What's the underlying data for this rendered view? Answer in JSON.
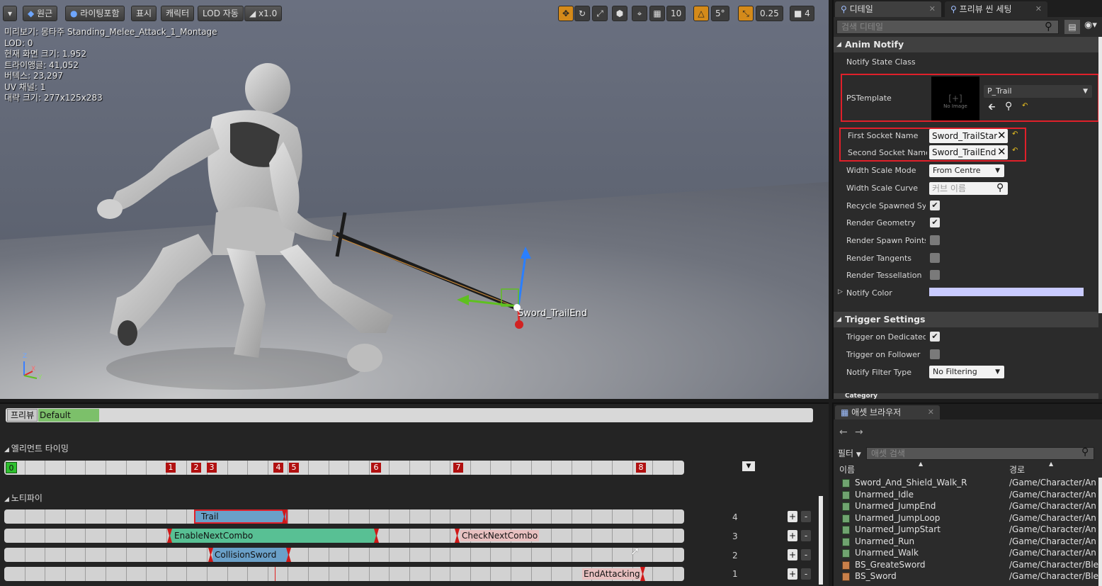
{
  "viewport": {
    "toolbar": {
      "perspective": "원근",
      "lighting": "라이팅포함",
      "show": "표시",
      "character": "캐릭터",
      "lod": "LOD 자동",
      "speed": "x1.0",
      "grid_snap": "10",
      "rotation_snap": "5°",
      "scale_snap": "0.25",
      "camera_speed": "4"
    },
    "stats": [
      "미리보기: 몽타주 Standing_Melee_Attack_1_Montage",
      "LOD: 0",
      "현재 화면 크기: 1.952",
      "트라이앵글: 41,052",
      "버텍스: 23,297",
      "UV 채널: 1",
      "대략 크기: 277x125x283"
    ],
    "socket_label": "Sword_TrailEnd",
    "axis": {
      "z": "Z",
      "x": "X",
      "y": "Y"
    }
  },
  "details": {
    "tabs": [
      {
        "label": "디테일"
      },
      {
        "label": "프리뷰 씬 세팅"
      }
    ],
    "search_placeholder": "검색 디테일",
    "anim_notify": {
      "title": "Anim Notify",
      "notify_state_class_label": "Notify State Class",
      "pstemplate_label": "PSTemplate",
      "pstemplate_value": "P_Trail",
      "thumb_text": "No Image",
      "first_socket_label": "First Socket Name",
      "first_socket_value": "Sword_TrailStar",
      "second_socket_label": "Second Socket Name",
      "second_socket_value": "Sword_TrailEnd",
      "width_scale_mode_label": "Width Scale Mode",
      "width_scale_mode_value": "From Centre",
      "width_scale_curve_label": "Width Scale Curve",
      "width_scale_curve_placeholder": "커브 이름",
      "recycle_label": "Recycle Spawned Systems",
      "render_geometry_label": "Render Geometry",
      "render_spawn_points_label": "Render Spawn Points",
      "render_tangents_label": "Render Tangents",
      "render_tessellation_label": "Render Tessellation",
      "notify_color_label": "Notify Color",
      "notify_color": "#c9cbff"
    },
    "trigger_settings": {
      "title": "Trigger Settings",
      "dedicated_label": "Trigger on Dedicated Server",
      "follower_label": "Trigger on Follower",
      "filter_type_label": "Notify Filter Type",
      "filter_type_value": "No Filtering"
    },
    "next_category": "Category"
  },
  "timeline": {
    "preview_label": "프리뷰",
    "preview_slot": "Default",
    "element_timing_label": "엘리먼트 타이밍",
    "first_marker": "0",
    "markers": [
      "1",
      "2",
      "3",
      "4",
      "5",
      "6",
      "7",
      "8"
    ],
    "notifies_label": "노티파이",
    "tracks": [
      {
        "number": "4",
        "notifies": [
          {
            "name": "Trail"
          }
        ]
      },
      {
        "number": "3",
        "notifies": [
          {
            "name": "EnableNextCombo"
          },
          {
            "name": "CheckNextCombo"
          }
        ]
      },
      {
        "number": "2",
        "notifies": [
          {
            "name": "CollisionSword"
          }
        ]
      },
      {
        "number": "1",
        "notifies": [
          {
            "name": "EndAttacking"
          }
        ]
      }
    ],
    "plus": "+",
    "minus": "-"
  },
  "assets": {
    "tab_label": "애셋 브라우저",
    "filter_label": "필터",
    "search_placeholder": "애셋 검색",
    "col_name": "이름",
    "col_path": "경로",
    "rows": [
      {
        "name": "Sword_And_Shield_Walk_R",
        "path": "/Game/Character/An",
        "type": "anim"
      },
      {
        "name": "Unarmed_Idle",
        "path": "/Game/Character/An",
        "type": "anim"
      },
      {
        "name": "Unarmed_JumpEnd",
        "path": "/Game/Character/An",
        "type": "anim"
      },
      {
        "name": "Unarmed_JumpLoop",
        "path": "/Game/Character/An",
        "type": "anim"
      },
      {
        "name": "Unarmed_JumpStart",
        "path": "/Game/Character/An",
        "type": "anim"
      },
      {
        "name": "Unarmed_Run",
        "path": "/Game/Character/An",
        "type": "anim"
      },
      {
        "name": "Unarmed_Walk",
        "path": "/Game/Character/An",
        "type": "anim"
      },
      {
        "name": "BS_GreateSword",
        "path": "/Game/Character/Ble",
        "type": "bs"
      },
      {
        "name": "BS_Sword",
        "path": "/Game/Character/Ble",
        "type": "bs"
      }
    ]
  }
}
